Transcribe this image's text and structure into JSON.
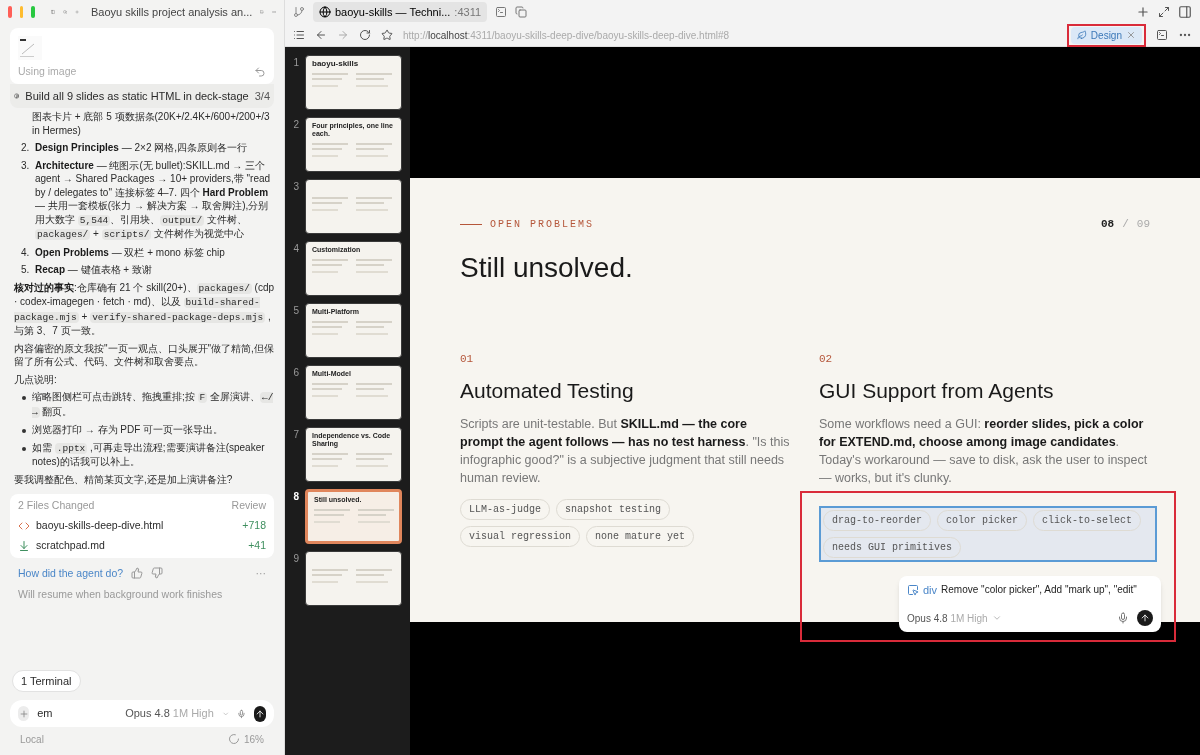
{
  "sidebar": {
    "title": "Baoyu skills project analysis an...",
    "attachment": {
      "caption": "Using image"
    },
    "task": {
      "text": "Build all 9 slides as static HTML in deck-stage",
      "progress": "3/4"
    },
    "list_continuation": [
      {
        "kind": "text",
        "text": "图表卡片 + 底部 5 项数据条(20K+/2.4K+/600+/200+/3 in Hermes)"
      }
    ],
    "list": [
      {
        "number": "2.",
        "segments": [
          {
            "kind": "bold",
            "text": "Design Principles"
          },
          {
            "kind": "text",
            "text": " — 2×2 网格,四条原则各一行"
          }
        ]
      },
      {
        "number": "3.",
        "segments": [
          {
            "kind": "bold",
            "text": "Architecture"
          },
          {
            "kind": "text",
            "text": " — 纯图示(无 bullet):SKILL.md → 三个 agent → Shared Packages → 10+ providers,带 \"read by / delegates to\" 连接标签 4–7. 四个 "
          },
          {
            "kind": "bold",
            "text": "Hard Problem"
          },
          {
            "kind": "text",
            "text": " — 共用一套模板(张力 → 解决方案 → 取舍脚注),分别用大数字 "
          },
          {
            "kind": "code",
            "text": "5,544"
          },
          {
            "kind": "text",
            "text": "、引用块、"
          },
          {
            "kind": "code",
            "text": "output/"
          },
          {
            "kind": "text",
            "text": " 文件树、"
          },
          {
            "kind": "code",
            "text": "packages/"
          },
          {
            "kind": "text",
            "text": " + "
          },
          {
            "kind": "code",
            "text": "scripts/"
          },
          {
            "kind": "text",
            "text": " 文件树作为视觉中心"
          }
        ]
      },
      {
        "number": "4.",
        "segments": [
          {
            "kind": "bold",
            "text": "Open Problems"
          },
          {
            "kind": "text",
            "text": " — 双栏 + mono 标签 chip"
          }
        ]
      },
      {
        "number": "5.",
        "segments": [
          {
            "kind": "bold",
            "text": "Recap"
          },
          {
            "kind": "text",
            "text": " — 键值表格 + 致谢"
          }
        ]
      }
    ],
    "paragraphs": [
      [
        {
          "kind": "bold",
          "text": "核对过的事实"
        },
        {
          "kind": "text",
          "text": ":仓库确有 21 个 skill(20+)、"
        },
        {
          "kind": "code",
          "text": "packages/"
        },
        {
          "kind": "text",
          "text": " (cdp · codex-imagegen · fetch · md)、以及 "
        },
        {
          "kind": "code",
          "text": "build-shared-package.mjs"
        },
        {
          "kind": "text",
          "text": " + "
        },
        {
          "kind": "code",
          "text": "verify-shared-package-deps.mjs"
        },
        {
          "kind": "text",
          "text": " ,与第 3、7 页一致。"
        }
      ],
      [
        {
          "kind": "text",
          "text": "内容偏密的原文我按\"一页一观点、口头展开\"做了精简,但保留了所有公式、代码、文件树和取舍要点。"
        }
      ],
      [
        {
          "kind": "text",
          "text": "几点说明:"
        }
      ]
    ],
    "bullets": [
      [
        {
          "kind": "text",
          "text": "缩略图侧栏可点击跳转、拖拽重排;按 "
        },
        {
          "kind": "code",
          "text": "F"
        },
        {
          "kind": "text",
          "text": " 全屏演讲、"
        },
        {
          "kind": "code",
          "text": "←/→"
        },
        {
          "kind": "text",
          "text": " 翻页。"
        }
      ],
      [
        {
          "kind": "text",
          "text": "浏览器打印 → 存为 PDF 可一页一张导出。"
        }
      ],
      [
        {
          "kind": "text",
          "text": "如需 "
        },
        {
          "kind": "code",
          "text": ".pptx"
        },
        {
          "kind": "text",
          "text": " ,可再走导出流程;需要演讲备注(speaker notes)的话我可以补上。"
        }
      ]
    ],
    "question": [
      {
        "kind": "text",
        "text": "要我调整配色、精简某页文字,还是加上演讲备注?"
      }
    ],
    "files_card": {
      "title": "2 Files Changed",
      "action": "Review",
      "files": [
        {
          "kind": "html",
          "name": "baoyu-skills-deep-dive.html",
          "added": "+718"
        },
        {
          "kind": "md",
          "name": "scratchpad.md",
          "added": "+41"
        }
      ]
    },
    "feedback": {
      "question": "How did the agent do?",
      "more": "···"
    },
    "status": "Will resume when background work finishes",
    "terminal_chip": "1 Terminal",
    "composer": {
      "value": "em",
      "model": "Opus 4.8",
      "effort": "1M High"
    },
    "footer": {
      "location": "Local",
      "usage": "16%"
    }
  },
  "browser": {
    "tab": {
      "title": "baoyu-skills — Techni...",
      "port": ":4311"
    },
    "url": {
      "scheme": "http://",
      "host": "localhost",
      "path": ":4311/baoyu-skills-deep-dive/baoyu-skills-deep-dive.html#8"
    },
    "design_chip": {
      "label": "Design",
      "highlighted": true
    }
  },
  "thumbnails": [
    {
      "number": "1",
      "title": "baoyu-skills",
      "selected": false
    },
    {
      "number": "2",
      "title": "Four principles, one line each.",
      "selected": false
    },
    {
      "number": "3",
      "selected": false
    },
    {
      "number": "4",
      "title": "Customization",
      "selected": false
    },
    {
      "number": "5",
      "title": "Multi-Platform",
      "selected": false
    },
    {
      "number": "6",
      "title": "Multi-Model",
      "selected": false
    },
    {
      "number": "7",
      "title": "Independence vs. Code Sharing",
      "selected": false
    },
    {
      "number": "8",
      "title": "Still unsolved.",
      "selected": true
    },
    {
      "number": "9",
      "selected": false
    }
  ],
  "slide": {
    "eyebrow": "OPEN PROBLEMS",
    "page": "08",
    "separator": "/",
    "total": "09",
    "title": "Still unsolved.",
    "columns": [
      {
        "number": "01",
        "title": "Automated Testing",
        "selected": false,
        "body": [
          {
            "kind": "text",
            "text": "Scripts are unit-testable. But "
          },
          {
            "kind": "bold",
            "text": "SKILL.md — the core prompt the agent follows — has no test harness"
          },
          {
            "kind": "text",
            "text": ". \"Is this infographic good?\" is a subjective judgment that still needs human review."
          }
        ],
        "tags": [
          "LLM-as-judge",
          "snapshot testing",
          "visual regression",
          "none mature yet"
        ]
      },
      {
        "number": "02",
        "title": "GUI Support from Agents",
        "selected": true,
        "body": [
          {
            "kind": "text",
            "text": "Some workflows need a GUI: "
          },
          {
            "kind": "bold",
            "text": "reorder slides, pick a color for EXTEND.md, choose among image candidates"
          },
          {
            "kind": "text",
            "text": ". Today's workaround — save to disk, ask the user to inspect — works, but it's clunky."
          }
        ],
        "tags": [
          "drag-to-reorder",
          "color picker",
          "click-to-select",
          "needs GUI primitives"
        ]
      }
    ],
    "prompt": {
      "element": "div",
      "value": "Remove \"color picker\", Add \"mark up\", \"edit\"",
      "model": "Opus 4.8",
      "effort": "1M High"
    }
  }
}
